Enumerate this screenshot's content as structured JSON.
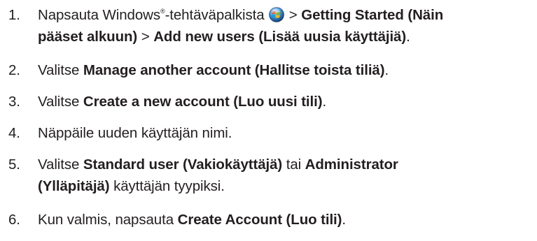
{
  "steps": [
    {
      "number": "1.",
      "lines": [
        {
          "pre_sup": "Napsauta Windows",
          "sup": "®",
          "post_sup": "-tehtäväpalkista ",
          "icon": "windows-start-orb-icon",
          "sep": " > ",
          "b1": "Getting Started (Näin",
          "sep2": ""
        },
        {
          "b1": "pääset alkuun)",
          "sep": " > ",
          "b2": "Add new users (Lisää uusia käyttäjiä)",
          "end": "."
        }
      ]
    },
    {
      "number": "2.",
      "pre": "Valitse ",
      "bold": "Manage another account (Hallitse toista tiliä)",
      "end": "."
    },
    {
      "number": "3.",
      "pre": "Valitse ",
      "bold": "Create a new account (Luo uusi tili)",
      "end": "."
    },
    {
      "number": "4.",
      "text": "Näppäile uuden käyttäjän nimi."
    },
    {
      "number": "5.",
      "line1": {
        "pre": "Valitse ",
        "b1": "Standard user (Vakiokäyttäjä)",
        "mid": " tai ",
        "b2": "Administrator"
      },
      "line2": {
        "b1": "(Ylläpitäjä)",
        "end": " käyttäjän tyypiksi."
      }
    },
    {
      "number": "6.",
      "pre": "Kun valmis, napsauta ",
      "bold": "Create Account (Luo tili)",
      "end": "."
    }
  ]
}
